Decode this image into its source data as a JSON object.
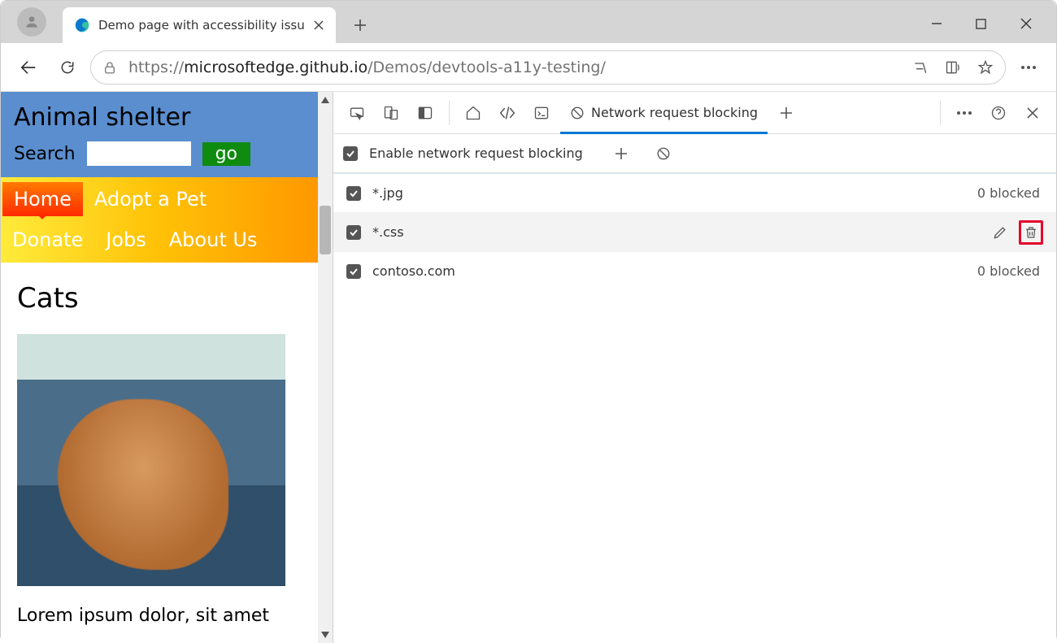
{
  "browser": {
    "tab_title": "Demo page with accessibility issu",
    "url_scheme": "https://",
    "url_host": "microsoftedge.github.io",
    "url_path": "/Demos/devtools-a11y-testing/"
  },
  "page": {
    "site_title": "Animal shelter",
    "search_label": "Search",
    "go_label": "go",
    "nav": {
      "home": "Home",
      "adopt": "Adopt a Pet",
      "donate": "Donate",
      "jobs": "Jobs",
      "about": "About Us"
    },
    "heading": "Cats",
    "lorem": "Lorem ipsum dolor, sit amet"
  },
  "devtools": {
    "active_tab_label": "Network request blocking",
    "enable_label": "Enable network request blocking",
    "items": [
      {
        "pattern": "*.jpg",
        "count": "0 blocked",
        "hover": false
      },
      {
        "pattern": "*.css",
        "count": "",
        "hover": true
      },
      {
        "pattern": "contoso.com",
        "count": "0 blocked",
        "hover": false
      }
    ]
  }
}
